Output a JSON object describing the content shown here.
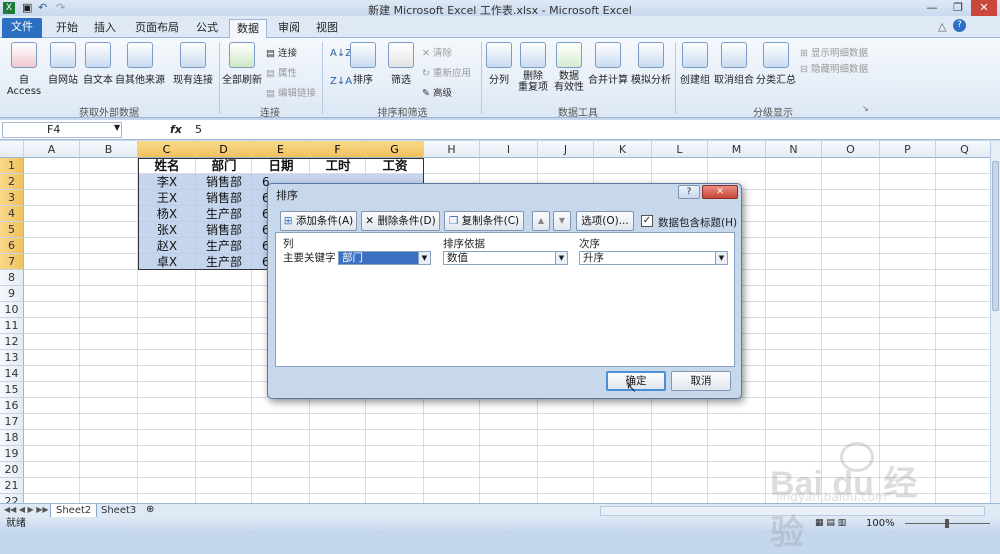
{
  "window": {
    "title": "新建 Microsoft Excel 工作表.xlsx - Microsoft Excel"
  },
  "tabs": [
    "文件",
    "开始",
    "插入",
    "页面布局",
    "公式",
    "数据",
    "审阅",
    "视图"
  ],
  "ribbon": {
    "get_external": {
      "buttons": [
        "自 Access",
        "自网站",
        "自文本",
        "自其他来源",
        "现有连接"
      ],
      "label": "获取外部数据"
    },
    "connections": {
      "refresh": "全部刷新",
      "small": [
        "连接",
        "属性",
        "编辑链接"
      ],
      "label": "连接"
    },
    "sortfilter": {
      "sort": "排序",
      "filter": "筛选",
      "small": [
        "清除",
        "重新应用",
        "高级"
      ],
      "label": "排序和筛选"
    },
    "datatools": {
      "buttons": [
        "分列",
        "删除\n重复项",
        "数据\n有效性",
        "合并计算",
        "模拟分析"
      ],
      "label": "数据工具"
    },
    "outline": {
      "buttons": [
        "创建组",
        "取消组合",
        "分类汇总"
      ],
      "small": [
        "显示明细数据",
        "隐藏明细数据"
      ],
      "label": "分级显示"
    }
  },
  "formula": {
    "cell_ref": "F4",
    "fx": "fx",
    "value": "5"
  },
  "columns": [
    "A",
    "B",
    "C",
    "D",
    "E",
    "F",
    "G",
    "H",
    "I",
    "J",
    "K",
    "L",
    "M",
    "N",
    "O",
    "P",
    "Q"
  ],
  "rows": [
    "1",
    "2",
    "3",
    "4",
    "5",
    "6",
    "7",
    "8",
    "9",
    "10",
    "11",
    "12",
    "13",
    "14",
    "15",
    "16",
    "17",
    "18",
    "19",
    "20",
    "21",
    "22"
  ],
  "table": {
    "headers": [
      "姓名",
      "部门",
      "日期",
      "工时",
      "工资"
    ],
    "names": [
      "李X",
      "王X",
      "杨X",
      "张X",
      "赵X",
      "卓X"
    ],
    "depts": [
      "销售部",
      "销售部",
      "生产部",
      "销售部",
      "生产部",
      "生产部"
    ],
    "dates": [
      "6",
      "6",
      "6",
      "6",
      "6",
      "6"
    ]
  },
  "sheets": [
    "Sheet2",
    "Sheet3"
  ],
  "status": {
    "ready": "就绪",
    "zoom": "100%"
  },
  "dialog": {
    "title": "排序",
    "help": "?",
    "add": "添加条件(A)",
    "delete": "删除条件(D)",
    "copy": "复制条件(C)",
    "up": "▲",
    "down": "▼",
    "options": "选项(O)...",
    "has_header": "数据包含标题(H)",
    "col_header": "列",
    "basis_header": "排序依据",
    "order_header": "次序",
    "row_label": "主要关键字",
    "key_value": "部门",
    "basis_value": "数值",
    "order_value": "升序",
    "ok": "确定",
    "cancel": "取消"
  }
}
